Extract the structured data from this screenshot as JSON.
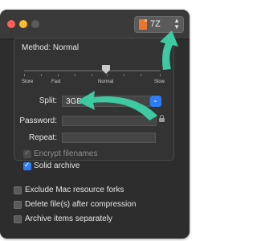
{
  "toolbar": {
    "format_value": "7Z",
    "format_icon": "archive-file-icon"
  },
  "compression": {
    "method_label": "Method: Normal",
    "slider_level": 0.6,
    "levels": [
      "Store",
      "Fast",
      "Normal",
      "Slow"
    ]
  },
  "split": {
    "label": "Split:",
    "value": "3GB"
  },
  "password": {
    "label": "Password:",
    "value": ""
  },
  "repeat": {
    "label": "Repeat:",
    "value": ""
  },
  "options": {
    "encrypt_filenames": {
      "label": "Encrypt filenames",
      "checked": true,
      "enabled": false
    },
    "solid_archive": {
      "label": "Solid archive",
      "checked": true
    }
  },
  "bottom_options": [
    {
      "label": "Exclude Mac resource forks",
      "checked": false
    },
    {
      "label": "Delete file(s) after compression",
      "checked": false
    },
    {
      "label": "Archive items separately",
      "checked": false
    }
  ],
  "colors": {
    "accent": "#2f7df6",
    "annotation": "#3ec9a0",
    "window": "#2d2d2d"
  }
}
